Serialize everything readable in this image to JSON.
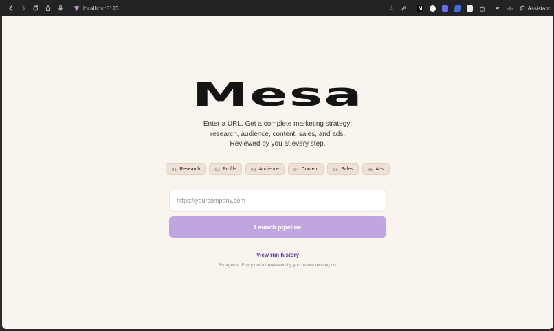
{
  "browser": {
    "url": "localhost:5173",
    "assistant_label": "Assistant",
    "extension_colors": [
      "#ffffff",
      "#6a6af0",
      "#3b6fe0",
      "#e8e8e8"
    ]
  },
  "page": {
    "logo": "Mesa",
    "tagline": [
      "Enter a URL. Get a complete marketing strategy:",
      "research, audience, content, sales, and ads.",
      "Reviewed by you at every step."
    ],
    "steps": [
      {
        "num": "01",
        "label": "Research"
      },
      {
        "num": "02",
        "label": "Profile"
      },
      {
        "num": "03",
        "label": "Audience"
      },
      {
        "num": "04",
        "label": "Content"
      },
      {
        "num": "05",
        "label": "Sales"
      },
      {
        "num": "06",
        "label": "Ads"
      }
    ],
    "url_input": {
      "value": "",
      "placeholder": "https://yourcompany.com"
    },
    "launch_label": "Launch pipeline",
    "history_link": "View run history",
    "footnote": "Six agents. Every output reviewed by you before moving on."
  },
  "colors": {
    "page_bg": "#faf4ef",
    "accent": "#c0a6e0",
    "link": "#5a3a9c"
  }
}
